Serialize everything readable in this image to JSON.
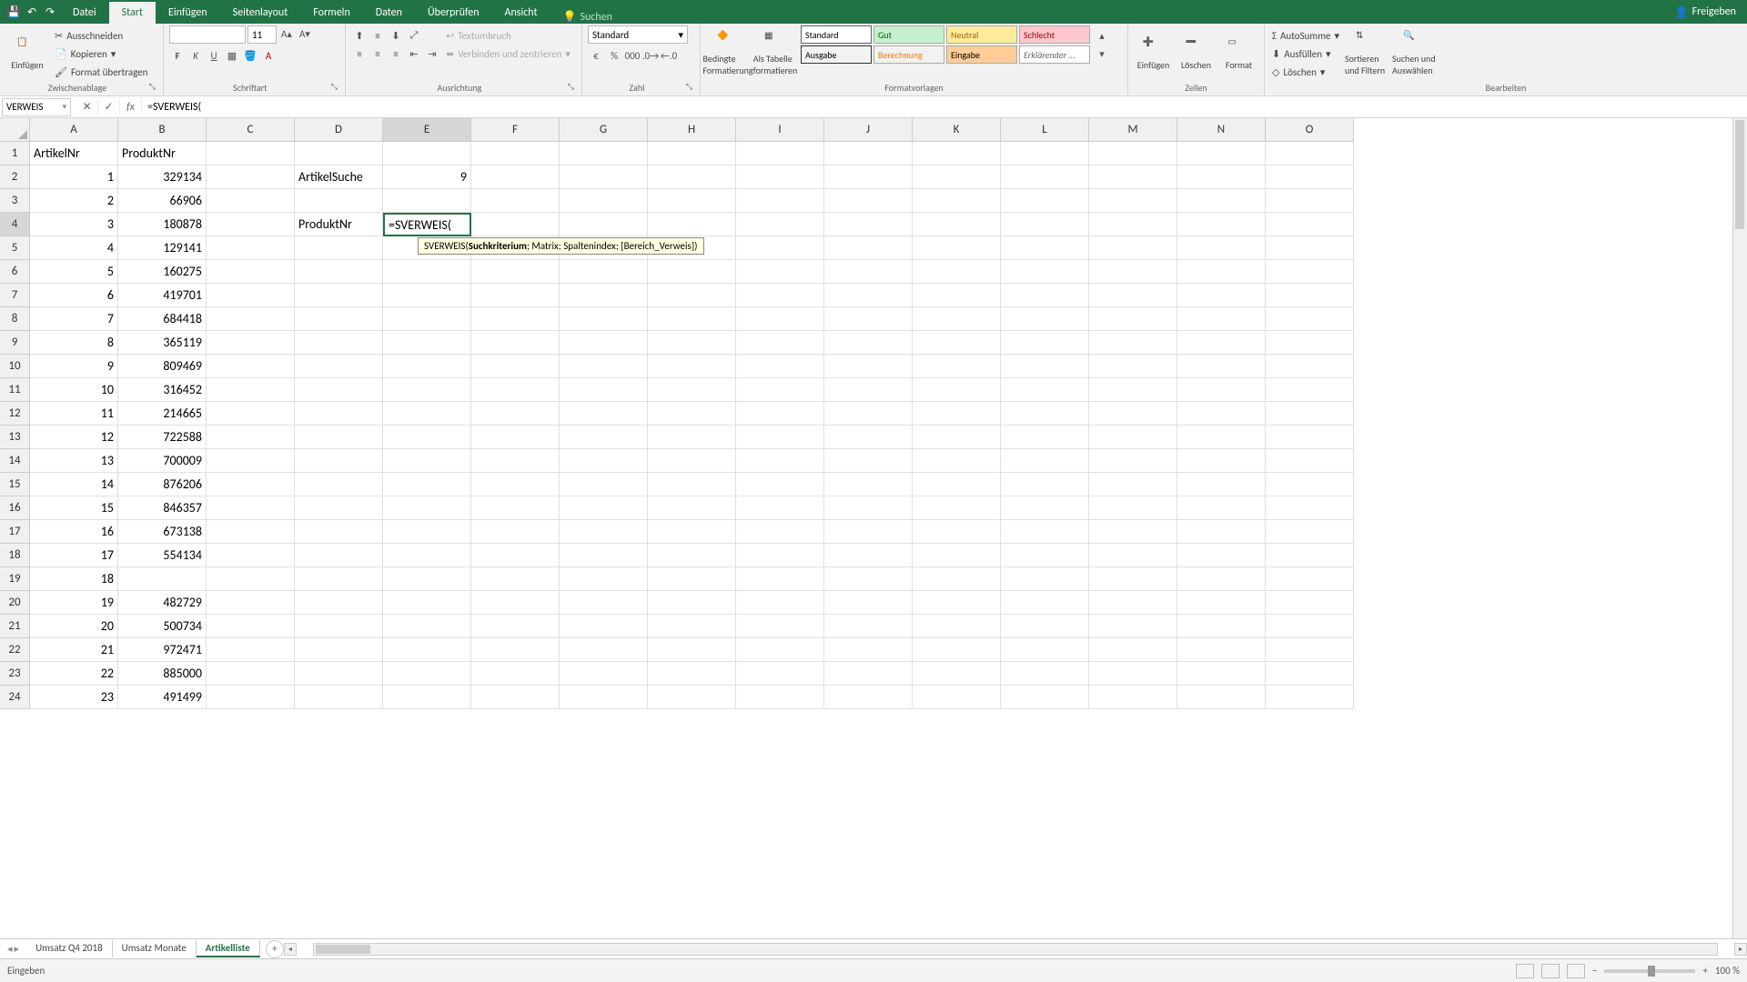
{
  "titlebar": {
    "search_hint": "Suchen",
    "share": "Freigeben"
  },
  "tabs": {
    "file": "Datei",
    "start": "Start",
    "einfuegen": "Einfügen",
    "seitenlayout": "Seitenlayout",
    "formeln": "Formeln",
    "daten": "Daten",
    "ueberpruefen": "Überprüfen",
    "ansicht": "Ansicht"
  },
  "ribbon": {
    "clipboard": {
      "paste": "Einfügen",
      "cut": "Ausschneiden",
      "copy": "Kopieren",
      "format_painter": "Format übertragen",
      "label": "Zwischenablage"
    },
    "font": {
      "name": "",
      "size": "11",
      "label": "Schriftart"
    },
    "alignment": {
      "wrap": "Textumbruch",
      "merge": "Verbinden und zentrieren",
      "label": "Ausrichtung"
    },
    "number": {
      "format": "Standard",
      "label": "Zahl"
    },
    "styles": {
      "cond": "Bedingte Formatierung",
      "table": "Als Tabelle formatieren",
      "standard": "Standard",
      "gut": "Gut",
      "neutral": "Neutral",
      "schlecht": "Schlecht",
      "ausgabe": "Ausgabe",
      "berechnung": "Berechnung",
      "eingabe": "Eingabe",
      "erklaerender": "Erklärender ...",
      "label": "Formatvorlagen"
    },
    "cells": {
      "insert": "Einfügen",
      "delete": "Löschen",
      "format": "Format",
      "label": "Zellen"
    },
    "editing": {
      "autosum": "AutoSumme",
      "fill": "Ausfüllen",
      "clear": "Löschen",
      "sort": "Sortieren und Filtern",
      "find": "Suchen und Auswählen",
      "label": "Bearbeiten"
    }
  },
  "formula_bar": {
    "name_box": "VERWEIS",
    "formula": "=SVERWEIS("
  },
  "columns": [
    "A",
    "B",
    "C",
    "D",
    "E",
    "F",
    "G",
    "H",
    "I",
    "J",
    "K",
    "L",
    "M",
    "N",
    "O"
  ],
  "rows_count": 24,
  "headers": {
    "A1": "ArtikelNr",
    "B1": "ProduktNr"
  },
  "labels": {
    "D2": "ArtikelSuche",
    "D4": "ProduktNr"
  },
  "values": {
    "E2": "9"
  },
  "editing_cell": {
    "ref": "E4",
    "text": "=SVERWEIS("
  },
  "tooltip": {
    "fn": "SVERWEIS(",
    "arg_bold": "Suchkriterium",
    "rest": "; Matrix; Spaltenindex; [Bereich_Verweis])"
  },
  "columnA": [
    1,
    2,
    3,
    4,
    5,
    6,
    7,
    8,
    9,
    10,
    11,
    12,
    13,
    14,
    15,
    16,
    17,
    18,
    19,
    20,
    21,
    22,
    23
  ],
  "columnB": [
    329134,
    66906,
    180878,
    129141,
    160275,
    419701,
    684418,
    365119,
    809469,
    316452,
    214665,
    722588,
    700009,
    876206,
    846357,
    673138,
    554134,
    "",
    482729,
    500734,
    972471,
    885000,
    491499
  ],
  "sheet_tabs": [
    "Umsatz Q4 2018",
    "Umsatz Monate",
    "Artikelliste"
  ],
  "active_sheet": "Artikelliste",
  "status": {
    "mode": "Eingeben",
    "zoom": "100 %"
  }
}
